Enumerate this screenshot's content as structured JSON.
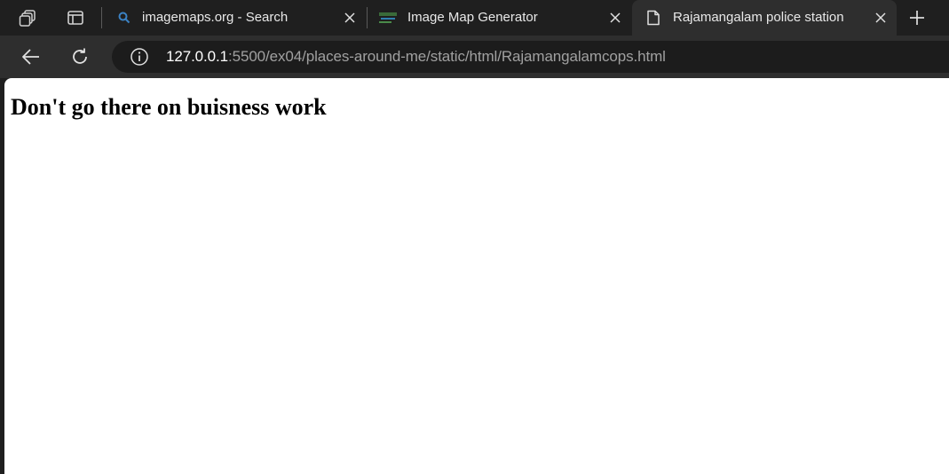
{
  "browser": {
    "tabs": [
      {
        "title": "imagemaps.org - Search",
        "favicon": "search-icon",
        "active": false
      },
      {
        "title": "Image Map Generator",
        "favicon": "imagemaps-logo-icon",
        "active": false
      },
      {
        "title": "Rajamangalam police station",
        "favicon": "document-icon",
        "active": true
      }
    ],
    "address": {
      "host": "127.0.0.1",
      "path": ":5500/ex04/places-around-me/static/html/Rajamangalamcops.html"
    },
    "colors": {
      "frame": "#1f1f1f",
      "toolbar": "#2e2e2e",
      "omnibox": "#1c1c1c",
      "search_accent": "#3b82c4"
    }
  },
  "page": {
    "heading": "Don't go there on buisness work"
  }
}
